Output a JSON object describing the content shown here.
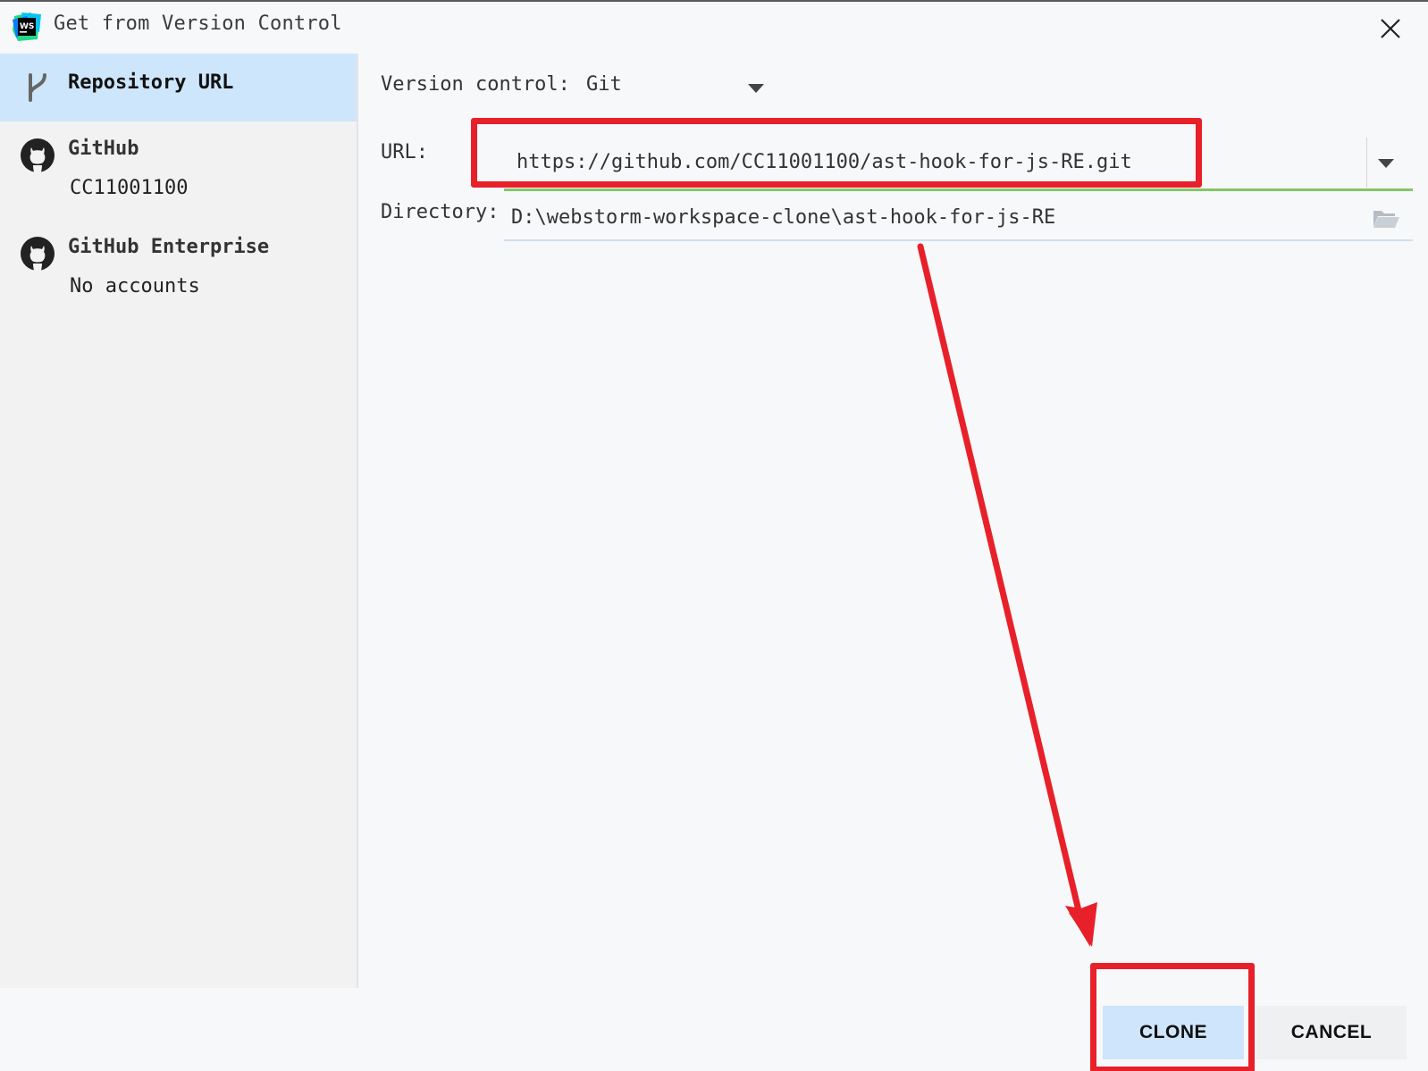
{
  "window": {
    "title": "Get from Version Control",
    "logo_text": "WS"
  },
  "sidebar": {
    "items": [
      {
        "title": "Repository URL",
        "subtitle": "",
        "icon": "vcs-branch-icon",
        "selected": true
      },
      {
        "title": "GitHub",
        "subtitle": "CC11001100",
        "icon": "github-icon",
        "selected": false
      },
      {
        "title": "GitHub Enterprise",
        "subtitle": "No accounts",
        "icon": "github-icon",
        "selected": false
      }
    ]
  },
  "form": {
    "version_control_label": "Version control:",
    "version_control_value": "Git",
    "url_label": "URL:",
    "url_value": "https://github.com/CC11001100/ast-hook-for-js-RE.git",
    "directory_label": "Directory:",
    "directory_value": "D:\\webstorm-workspace-clone\\ast-hook-for-js-RE"
  },
  "buttons": {
    "clone": "CLONE",
    "cancel": "CANCEL"
  },
  "colors": {
    "selection": "#cde6fb",
    "annotation": "#e8202a",
    "valid_underline": "#86c568",
    "primary_button": "#cfe5fb"
  }
}
